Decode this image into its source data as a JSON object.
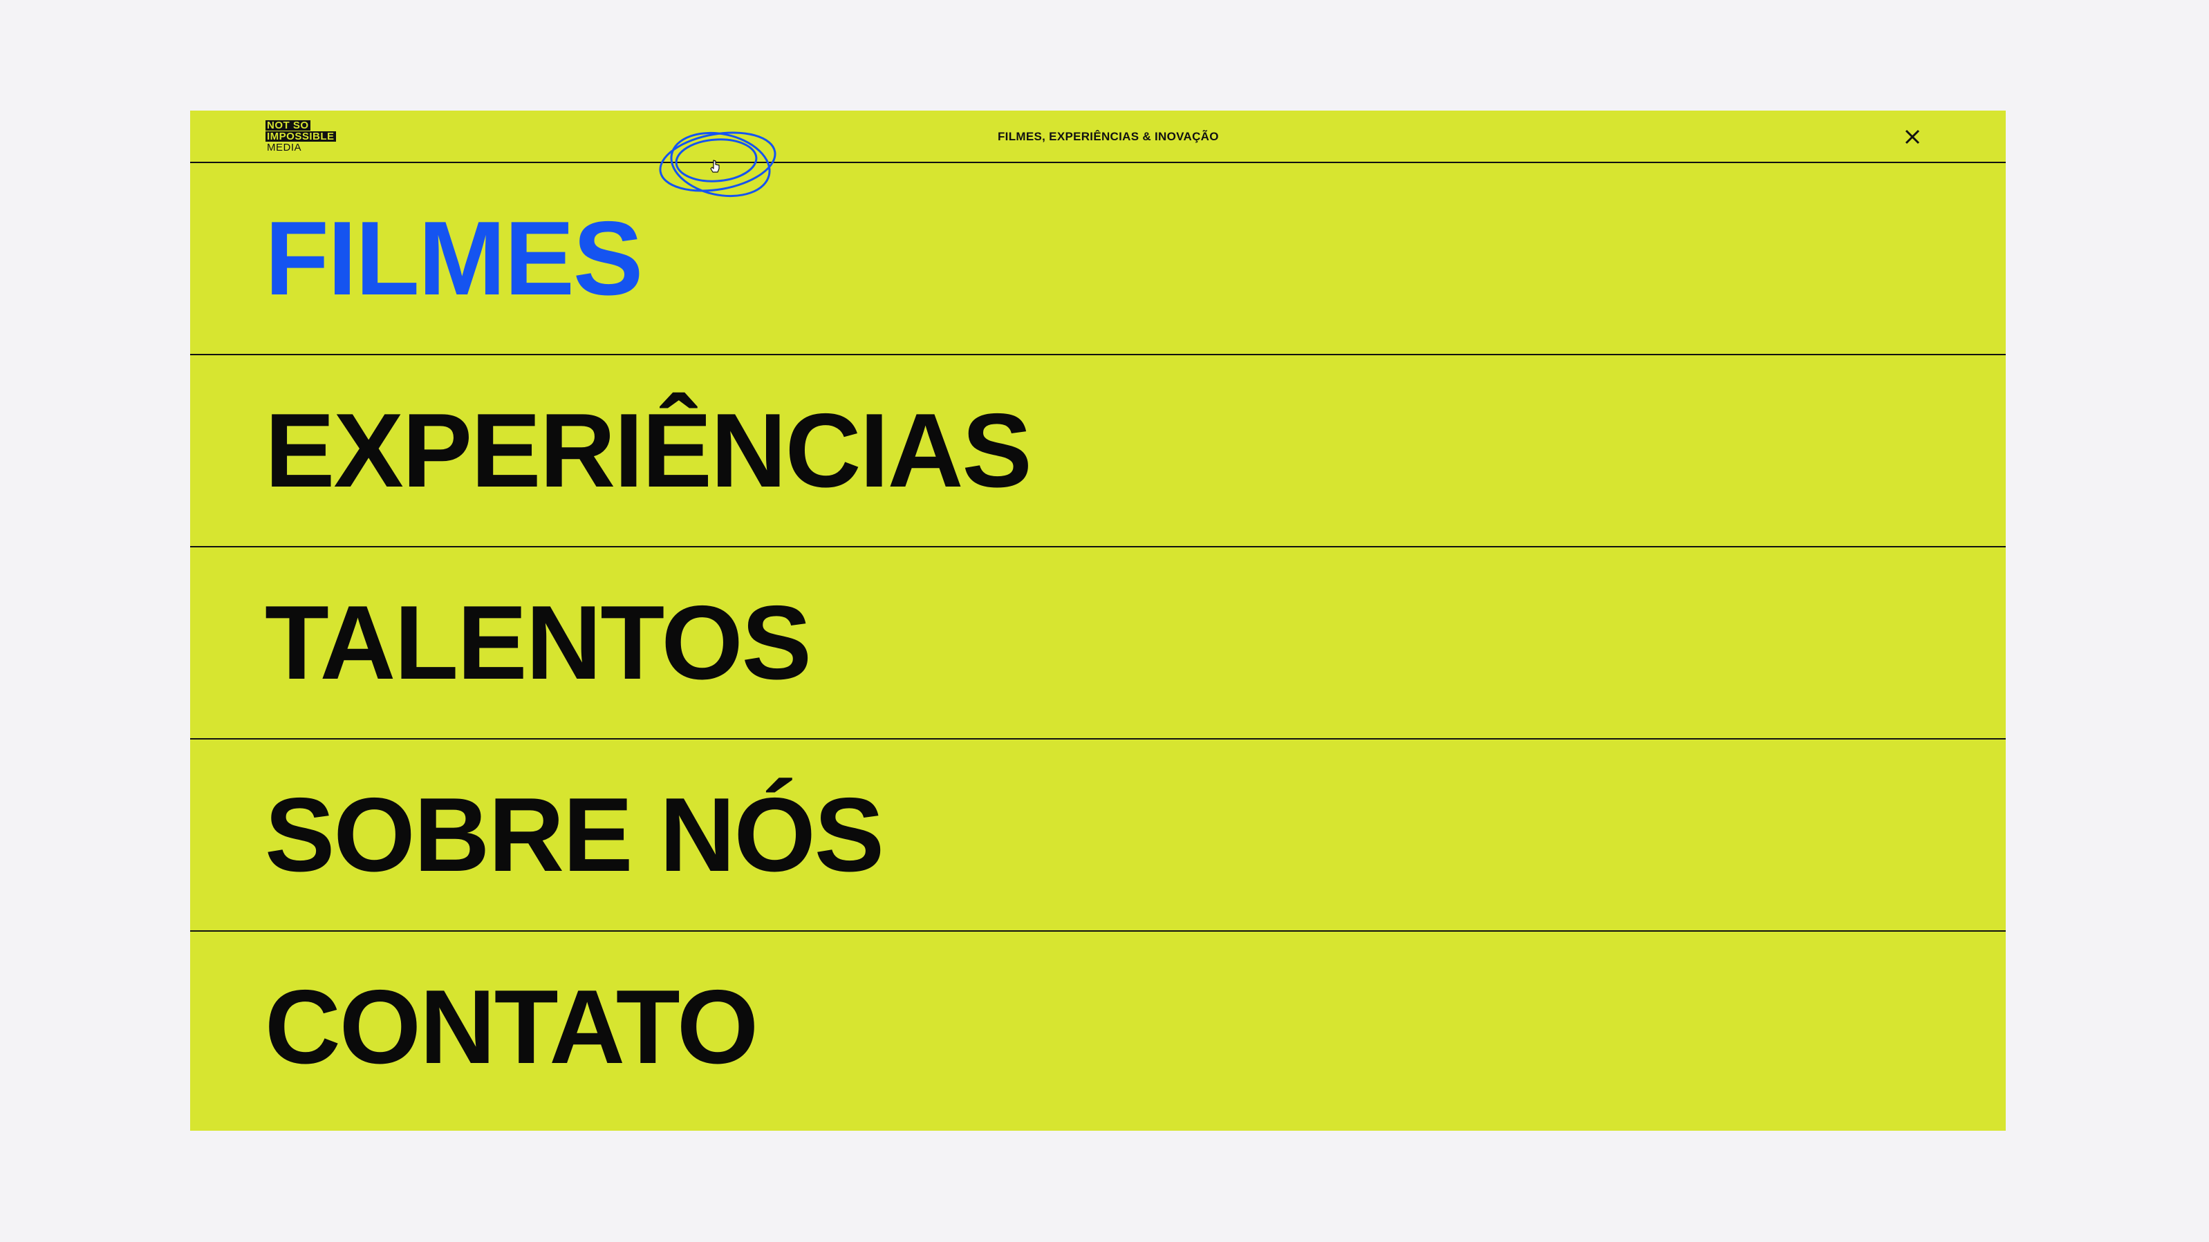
{
  "brand": {
    "logo_line1": "NOT SO",
    "logo_line2": "IMPOSSIBLE",
    "logo_line3": "MEDIA"
  },
  "header": {
    "tagline": "FILMES, EXPERIÊNCIAS & INOVAÇÃO",
    "close_icon": "close-icon"
  },
  "menu": {
    "items": [
      {
        "label": "FILMES",
        "active": true
      },
      {
        "label": "EXPERIÊNCIAS",
        "active": false
      },
      {
        "label": "TALENTOS",
        "active": false
      },
      {
        "label": "SOBRE NÓS",
        "active": false
      },
      {
        "label": "CONTATO",
        "active": false
      }
    ]
  },
  "colors": {
    "background": "#f4f3f6",
    "panel": "#d7e530",
    "accent": "#1554f0",
    "text": "#0a0a0a"
  },
  "icons": {
    "orbit": "orbit-rings-icon",
    "cursor": "hand-pointer-icon"
  }
}
